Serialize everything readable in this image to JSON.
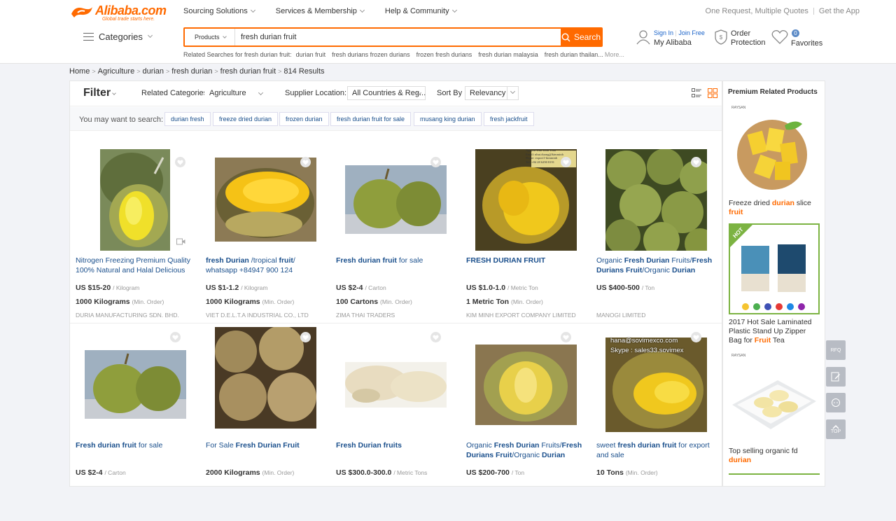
{
  "brand": {
    "name": "Alibaba.com",
    "tagline": "Global trade starts here.",
    "color": "#ff6a00"
  },
  "topnav": [
    "Sourcing Solutions",
    "Services & Membership",
    "Help & Community"
  ],
  "topright": {
    "quotes": "One Request, Multiple Quotes",
    "app": "Get the App"
  },
  "categories_label": "Categories",
  "search": {
    "type": "Products",
    "query": "fresh durian fruit",
    "button": "Search"
  },
  "related": {
    "label": "Related Searches for fresh durian fruit:",
    "items": [
      "durian fruit",
      "fresh durians frozen durians",
      "frozen fresh durians",
      "fresh durian malaysia",
      "fresh durian thailan..."
    ],
    "more": "More..."
  },
  "account": {
    "signin": "Sign In",
    "join": "Join Free",
    "my": "My Alibaba"
  },
  "order": {
    "line1": "Order",
    "line2": "Protection"
  },
  "favorites": {
    "count": "0",
    "label": "Favorites"
  },
  "breadcrumb": [
    "Home",
    "Agriculture",
    "durian",
    "fresh durian",
    "fresh durian fruit"
  ],
  "results": "814 Results",
  "filter": {
    "title": "Filter",
    "related_label": "Related Categories:",
    "related_value": "Agriculture",
    "supplier_label": "Supplier Location:",
    "supplier_value": "All Countries & Reg...",
    "sort_label": "Sort By :",
    "sort_value": "Relevancy"
  },
  "suggest": {
    "label": "You may want to search:",
    "chips": [
      "durian fresh",
      "freeze dried durian",
      "frozen durian",
      "fresh durian fruit for sale",
      "musang king durian",
      "fresh jackfruit"
    ]
  },
  "products": [
    {
      "title_html": "Nitrogen Freezing Premium Quality 100% Natural and Halal Delicious",
      "price": "US $15-20",
      "price_unit": "/ Kilogram",
      "moq": "1000 Kilograms",
      "moq_unit": "(Min. Order)",
      "supplier": "DURIA MANUFACTURING SDN. BHD."
    },
    {
      "title_html": "<b>fresh Durian</b> /tropical <b>fruit</b>/ whatsapp +84947 900 124",
      "price": "US $1-1.2",
      "price_unit": "/ Kilogram",
      "moq": "1000 Kilograms",
      "moq_unit": "(Min. Order)",
      "supplier": "VIET D.E.L.T.A INDUSTRIAL CO., LTD"
    },
    {
      "title_html": "<b>Fresh durian fruit</b> for sale",
      "price": "US $2-4",
      "price_unit": "/ Carton",
      "moq": "100 Cartons",
      "moq_unit": "(Min. Order)",
      "supplier": "ZIMA THAI TRADERS"
    },
    {
      "title_html": "<b>FRESH DURIAN FRUIT</b>",
      "price": "US $1.0-1.0",
      "price_unit": "/ Metric Ton",
      "moq": "1 Metric Ton",
      "moq_unit": "(Min. Order)",
      "supplier": "KIM MINH EXPORT COMPANY LIMITED"
    },
    {
      "title_html": "Organic <b>Fresh Durian</b> Fruits/<b>Fresh Durians Fruit</b>/Organic <b>Durian</b>",
      "price": "US $400-500",
      "price_unit": "/ Ton",
      "moq": "",
      "moq_unit": "",
      "supplier": "MANOGI LIMITED"
    },
    {
      "title_html": "<b>Fresh durian fruit</b> for sale",
      "price": "US $2-4",
      "price_unit": "/ Carton",
      "moq": "",
      "moq_unit": "",
      "supplier": ""
    },
    {
      "title_html": "For Sale <b>Fresh Durian Fruit</b>",
      "price": "2000 Kilograms",
      "price_unit": "(Min. Order)",
      "moq": "",
      "moq_unit": "",
      "supplier": ""
    },
    {
      "title_html": "<b>Fresh Durian fruits</b>",
      "price": "US $300.0-300.0",
      "price_unit": "/ Metric Tons",
      "moq": "",
      "moq_unit": "",
      "supplier": ""
    },
    {
      "title_html": "Organic <b>Fresh Durian</b> Fruits/<b>Fresh Durians Fruit</b>/Organic <b>Durian</b>",
      "price": "US $200-700",
      "price_unit": "/ Ton",
      "moq": "",
      "moq_unit": "",
      "supplier": ""
    },
    {
      "title_html": "sweet <b>fresh durian fruit</b> for export and sale",
      "price": "10 Tons",
      "price_unit": "(Min. Order)",
      "moq": "",
      "moq_unit": "",
      "supplier": ""
    }
  ],
  "image_overlays": {
    "p4": [
      "Nguyen Kim Linh Toan",
      "Email: nhut.duong@kimminh",
      "Skype: export1-kimminh",
      "Tel: +84 28 6290 8191"
    ],
    "p10": [
      "hana@sovimexco.com",
      "Skype : sales33.sovimex"
    ]
  },
  "side": {
    "title": "Premium Related Products",
    "badge": "HOT",
    "raysan": "RAYSAN",
    "ads": [
      {
        "pre": "Freeze dried ",
        "hl1": "durian",
        "mid": " slice ",
        "hl2": "fruit",
        "post": ""
      },
      {
        "pre": "2017 Hot Sale Laminated Plastic Stand Up Zipper Bag for ",
        "hl1": "Fruit",
        "mid": " Tea",
        "hl2": "",
        "post": ""
      },
      {
        "pre": "Top selling organic fd ",
        "hl1": "durian",
        "mid": "",
        "hl2": "",
        "post": ""
      }
    ]
  },
  "floatbuttons": {
    "rfq": "RFQ",
    "top": "TOP"
  }
}
